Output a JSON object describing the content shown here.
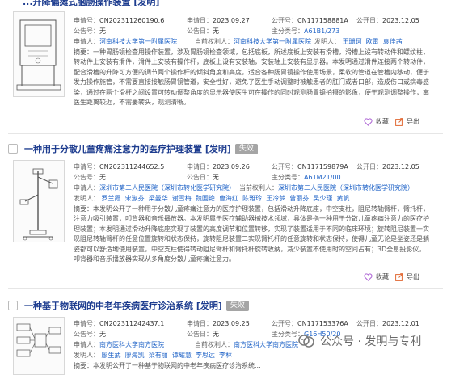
{
  "labels": {
    "app_no": "申请号：",
    "app_date": "申请日：",
    "pub_no": "公开号：",
    "pub_date": "公开日：",
    "announce_no": "公告号：",
    "announce_date": "公告日：",
    "ipc": "主分类号：",
    "applicant": "申请人：",
    "current_holder": "当前权利人：",
    "inventor": "发明人：",
    "abstract": "摘要："
  },
  "actions": {
    "favorite": "收藏",
    "export": "导出"
  },
  "colors": {
    "title": "#1d3c8f",
    "link": "#1f63c7",
    "badge": "#a5a5a5",
    "favorite_icon": "#b06ad6",
    "export_icon": "#e26a35"
  },
  "records": [
    {
      "title": "...升降偏瘫式脑肠操作装置 [发明]",
      "status": "",
      "app_no": "CN202311260190.6",
      "app_date": "2023.09.27",
      "pub_no": "CN117158881A",
      "pub_date": "2023.12.05",
      "announce_no": "无",
      "announce_date": "无",
      "ipc": "A61B1/273",
      "applicant": "河南科技大学第一附属医院",
      "current_holder": "河南科技大学第一附属医院",
      "inventors": [
        "王珊珂",
        "欧雷",
        "袁佳茜"
      ],
      "abstract": "一种胃肠镜检查用操作装置，涉及胃肠镜检查领域，包括底板，所述底板上安装有滑槽，滑槽上设有转动件和螺纹柱，转动件上安装有滑件，滑件上安装有操作杆，底板上设有安装轴，安装轴上安装有显示器。本发明通过滑件连接两个转动件，配合滑槽的升降可方便的调节两个操作杆的倾斜角度和高度，适合各种肠胃镜操作使用场景，柔软的管道在管槽内移动，便于发力操作施管，不需要直接接触肠胃镜管道，安全性好，避免了医生手动调整时被触患者的肛门或者口部，造成伤口或病毒感染，通过在两个滑杆之间设置可转动调整角度的显示器使医生可在操作的同时观测肠胃镜拍摄的影像，便于观测调整操作，离医生距离较近，不需要转头，观测清晰。"
    },
    {
      "title": "一种用于分散儿童疼痛注意力的医疗护理装置 [发明]",
      "status": "失效",
      "app_no": "CN202311244652.5",
      "app_date": "2023.09.26",
      "pub_no": "CN117159879A",
      "pub_date": "2023.12.05",
      "announce_no": "无",
      "announce_date": "无",
      "ipc": "A61M21/00",
      "applicant": "深圳市第二人民医院（深圳市转化医学研究院）",
      "current_holder": "深圳市第二人民医院（深圳市转化医学研究院）",
      "inventors": [
        "罗兰霞",
        "宋淑芬",
        "梁曼华",
        "谢雪梅",
        "魏国艳",
        "曹海红",
        "陈雅玲",
        "王冷梦",
        "曾丽芬",
        "吴少瑾",
        "黄帆"
      ],
      "abstract": "本发明公开了一种用于分散儿童疼痛注意力的医疗护理装置，包括滑动升降底座，中空支柱，阻尼转轴臂杆，臂托杆，注意力吸引装置，叩背器和音乐播放器。本发明属于医疗辅助器械技术领域，具体是指一种用于分散儿童疼痛注意力的医疗护理装置；本发明通过滑动升降底座实现了装置的高度调节和位置转移，实现了装置适用于不同的临床环境；旋转阻尼装置一实现阻尼转轴臂杆的任意位置旋转和状态保持，旋转阻尼装置二实现臂托杆的任意旋转和状态保持，使得儿童无论是坐姿还是躺姿都可以舒适地使用装置，中空支柱使得转动阻尼臂杆和臂托杆旋转收纳，减少装置不使用时的空间占有；3D全息投影仪，叩背器和音乐播放器实现从多角度分散儿童疼痛注意力。"
    },
    {
      "title": "一种基于物联网的中老年疾病医疗诊治系统 [发明]",
      "status": "失效",
      "app_no": "CN202311242437.1",
      "app_date": "2023.09.25",
      "pub_no": "CN117153376A",
      "pub_date": "2023.12.01",
      "announce_no": "无",
      "announce_date": "无",
      "ipc": "G16H50/20",
      "applicant": "南方医科大学南方医院",
      "current_holder": "南方医科大学南方医院",
      "inventors": [
        "廖生武",
        "廖海凯",
        "梁有丽",
        "谭耀慧",
        "李思远",
        "李林"
      ],
      "abstract": "本发明公开了一种基于物联网的中老年疾病医疗诊治系统..."
    }
  ],
  "watermark": "公众号 · 发明与专利"
}
